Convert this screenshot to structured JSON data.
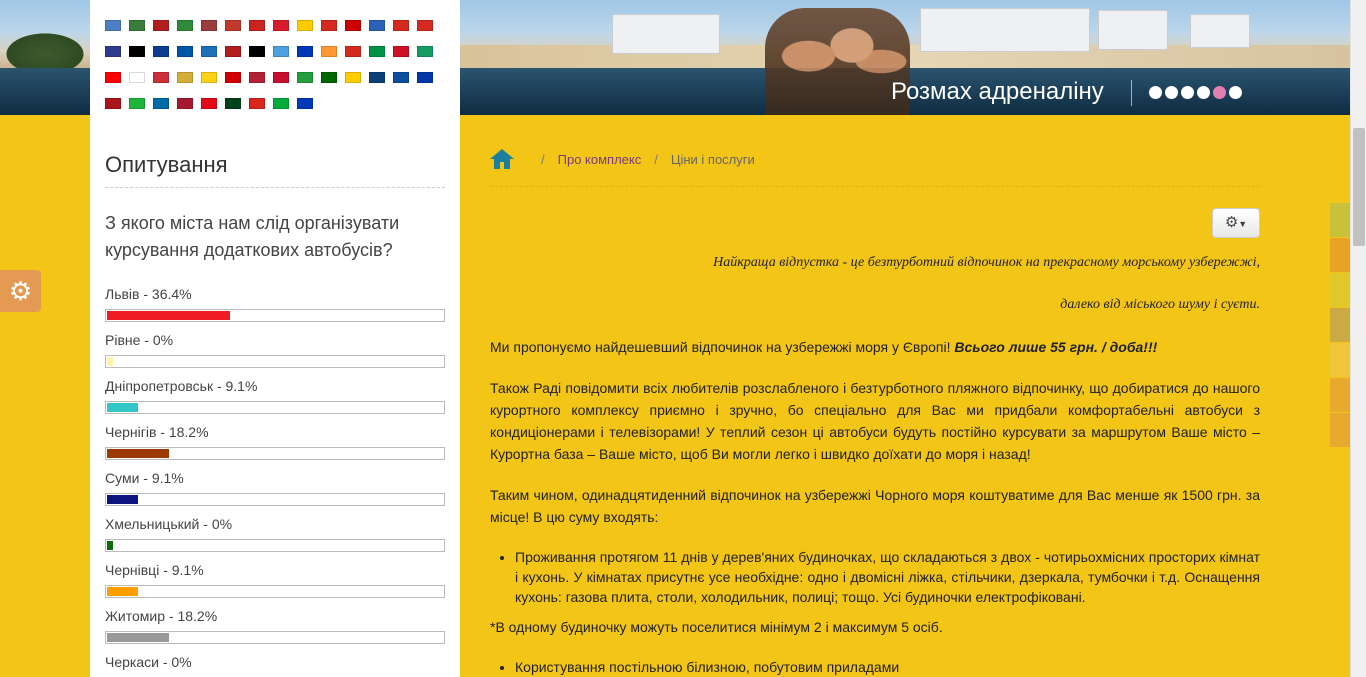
{
  "banner": {
    "slogan": "Розмах адреналіну",
    "slide_count": 6,
    "active_slide": 5
  },
  "flags": [
    "#4e7fc4",
    "#3a7d3a",
    "#b01e1e",
    "#2d8b3a",
    "#9c3b3b",
    "#c0392b",
    "#cc2222",
    "#d81c2e",
    "#ffcc00",
    "#d52b1e",
    "#cc0000",
    "#2a62b8",
    "#d52b1e",
    "#d52b1e",
    "#2f3a8f",
    "#000000",
    "#0b3d91",
    "#0055a4",
    "#1d6fb8",
    "#b01e1e",
    "#000000",
    "#4e9fdd",
    "#0038b8",
    "#ff9933",
    "#d52b1e",
    "#009246",
    "#ce1126",
    "#169b62",
    "#ff0000",
    "#ffffff",
    "#cd2e3a",
    "#d4af37",
    "#fcd116",
    "#d20000",
    "#b22234",
    "#c8102e",
    "#239f40",
    "#006600",
    "#ffcc00",
    "#0c4076",
    "#0b4ea2",
    "#0038a8",
    "#aa151b",
    "#1eb53a",
    "#006aa7",
    "#a51931",
    "#e30a17",
    "#01411c",
    "#da251d",
    "#00ab39",
    "#0038b8"
  ],
  "poll": {
    "title": "Опитування",
    "question": "З якого міста нам слід організувати курсування додаткових автобусів?",
    "options": [
      {
        "label": "Львів - 36.4%",
        "percent": 36.4,
        "color": "#ee1c24"
      },
      {
        "label": "Рівне - 0%",
        "percent": 0,
        "color": "#fff4a3"
      },
      {
        "label": "Дніпропетровськ - 9.1%",
        "percent": 9.1,
        "color": "#33c6c9"
      },
      {
        "label": "Чернігів - 18.2%",
        "percent": 18.2,
        "color": "#9c3a00"
      },
      {
        "label": "Суми - 9.1%",
        "percent": 9.1,
        "color": "#0d1480"
      },
      {
        "label": "Хмельницький - 0%",
        "percent": 0,
        "color": "#0b6b0b"
      },
      {
        "label": "Чернівці - 9.1%",
        "percent": 9.1,
        "color": "#ff9e00"
      },
      {
        "label": "Житомир - 18.2%",
        "percent": 18.2,
        "color": "#999999"
      },
      {
        "label": "Черкаси - 0%",
        "percent": 0,
        "color": "#f0c070"
      }
    ]
  },
  "breadcrumb": {
    "link": "Про комплекс",
    "current": "Ціни і послуги",
    "separator": "/"
  },
  "content": {
    "quote1": "Найкраща відпустка - це безтурботний відпочинок на прекрасному морському узбережжі,",
    "quote2": "далеко від міського шуму і суєти.",
    "p1_text": "Ми пропонуємо найдешевший відпочинок на узбережжі моря у Європі! ",
    "p1_bold": "Всього лише 55 грн. / доба!!!",
    "p2": "Також Раді повідомити всіх любителів розслабленого і безтурботного пляжного відпочинку, що добиратися до нашого курортного комплексу приємно і зручно, бо спеціально для Вас ми придбали комфортабельні автобуси з кондиціонерами і телевізорами! У теплий сезон ці автобуси будуть постійно курсувати за маршрутом Ваше місто – Курортна база – Ваше місто, щоб Ви могли легко і швидко доїхати до моря і назад!",
    "p3": "Таким чином, одинадцятиденний відпочинок на узбережжі Чорного моря коштуватиме для Вас менше як 1500 грн. за місце! В цю суму входять:",
    "li1": "Проживання протягом 11 днів у дерев'яних будиночках, що складаються з двох - чотирьохмісних просторих кімнат і кухонь. У кімнатах присутнє усе необхідне: одно і двомісні ліжка, стільчики, дзеркала, тумбочки і т.д. Оснащення кухонь: газова плита, столи, холодильник, полиці; тощо. Усі будиночки електрофіковані.",
    "note": "*В одному будиночку можуть поселитися мінімум 2 і максимум 5 осіб.",
    "li2": "Користування постільною білизною, побутовим приладами"
  },
  "strip_colors": [
    "#c8c23a",
    "#e8a324",
    "#e0c82a",
    "#c9aa45",
    "#efc63a",
    "#e9a82e",
    "#e9a82e"
  ],
  "icons": {
    "settings": "gear-icon",
    "home": "home-icon"
  }
}
